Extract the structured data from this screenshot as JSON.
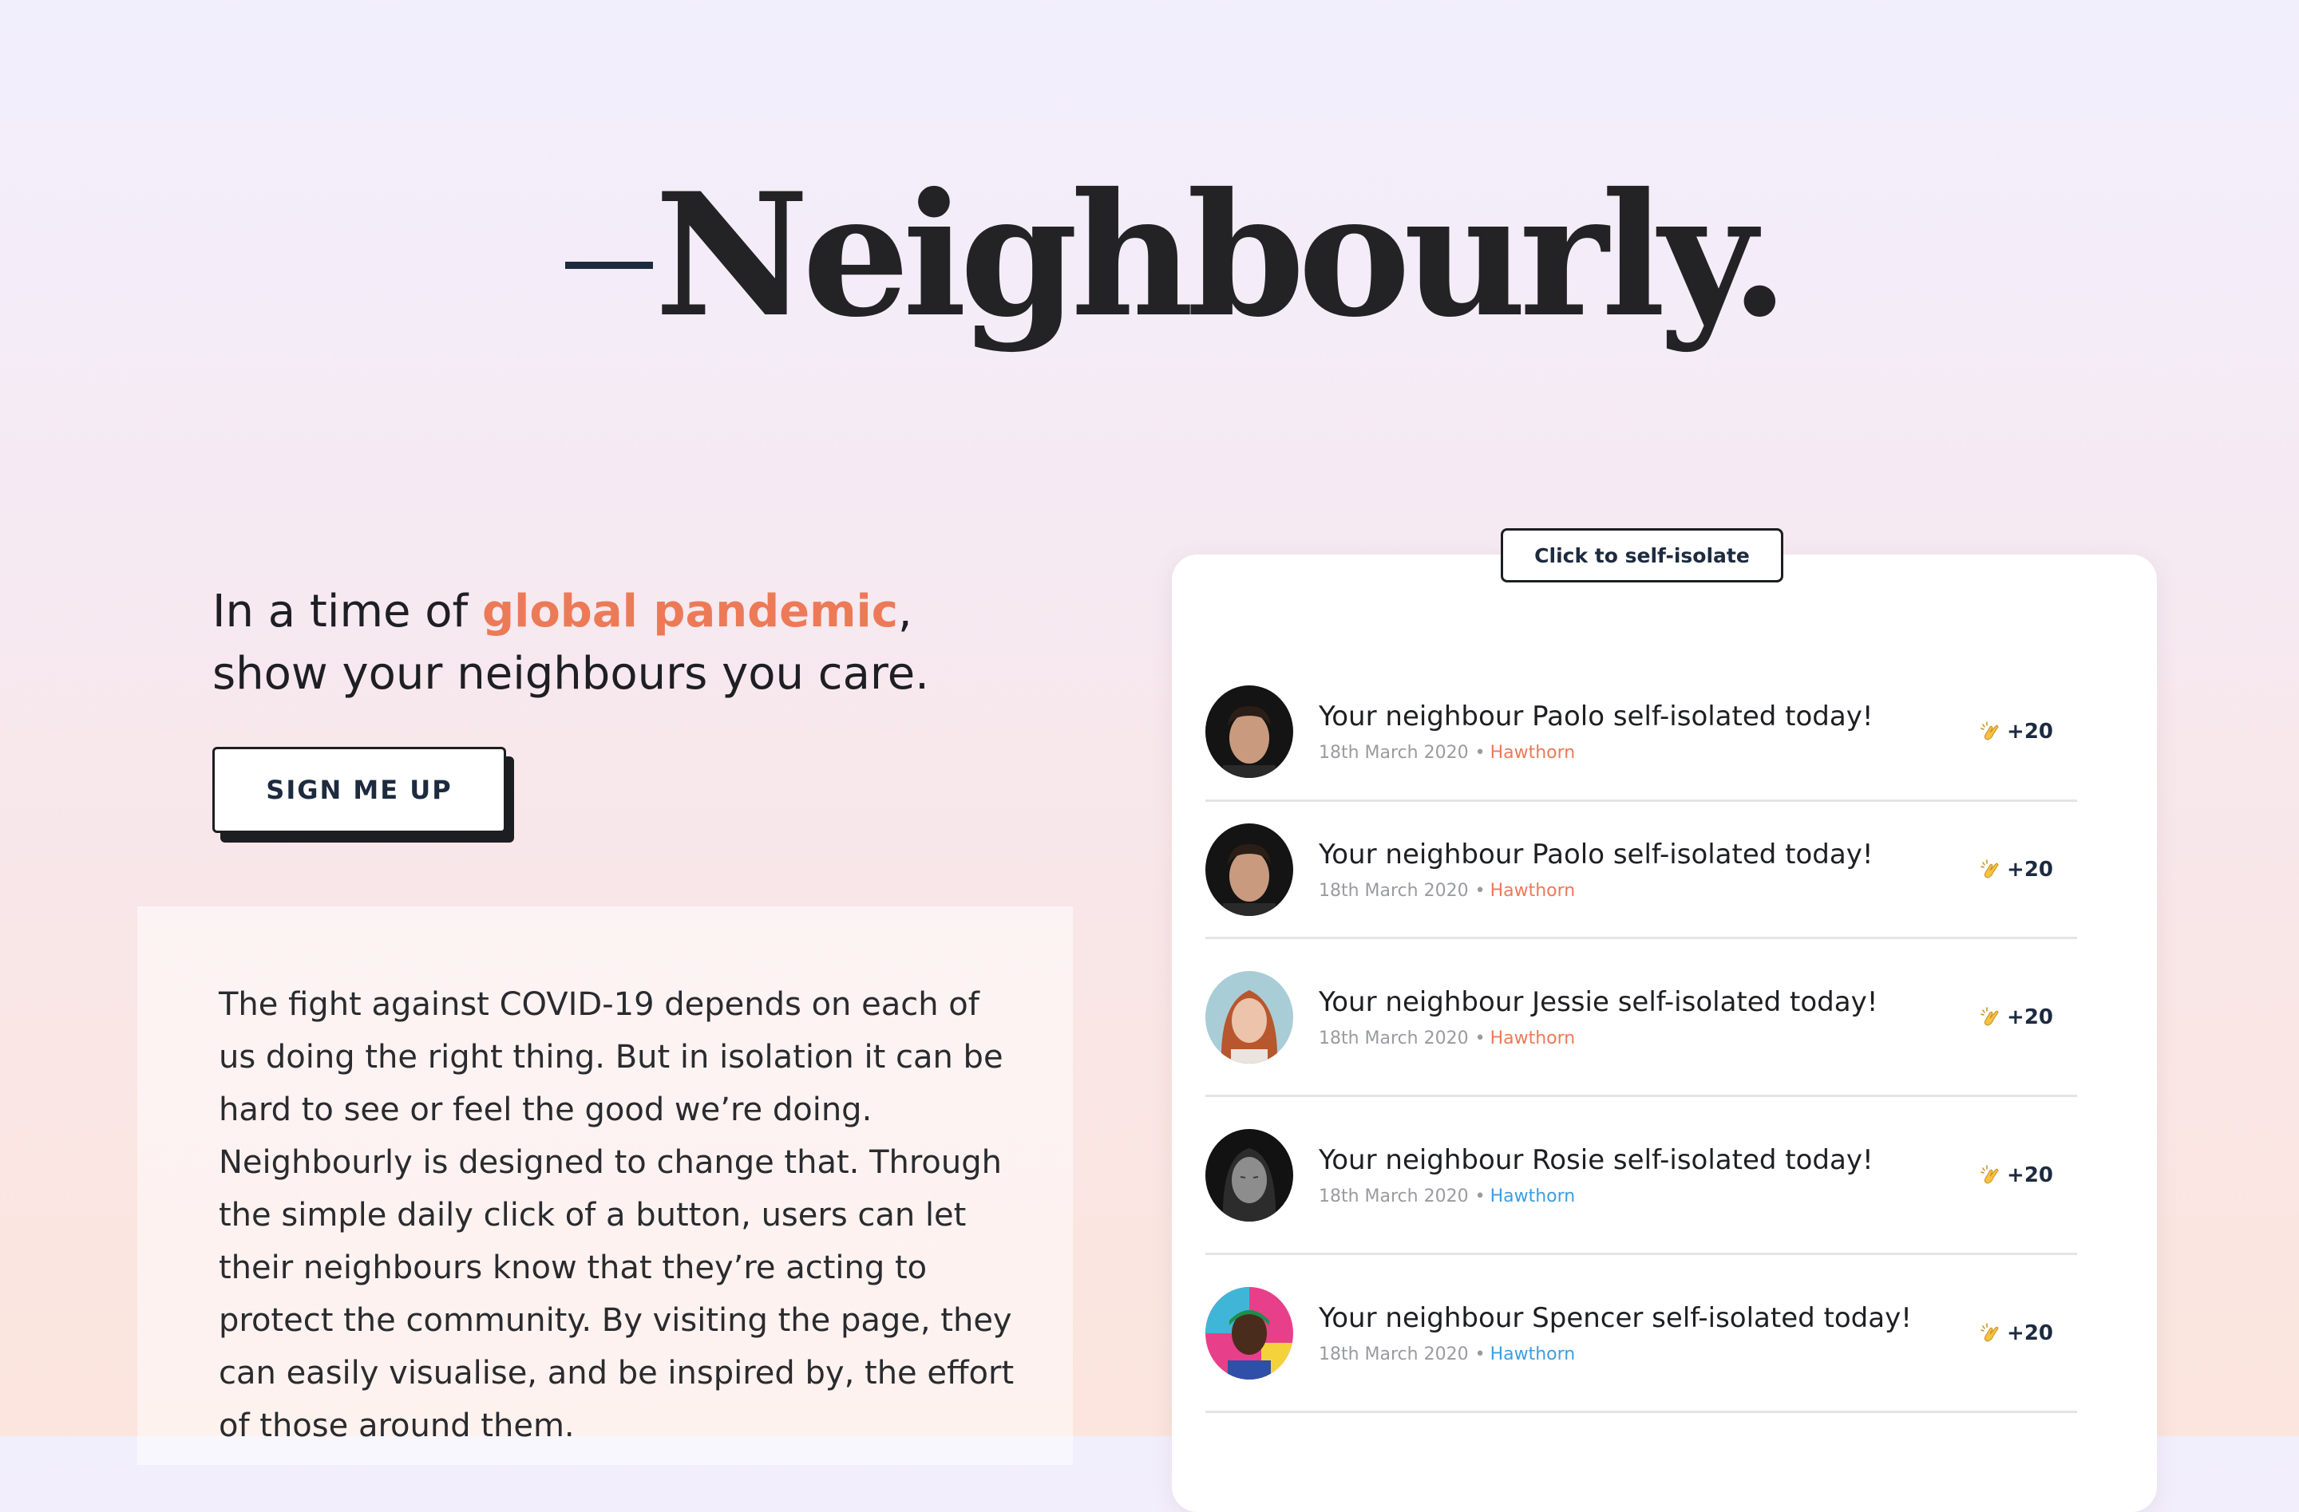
{
  "brand": {
    "logo_text": "Neighbourly."
  },
  "hero": {
    "headline_before": "In a time of ",
    "headline_accent": "global pandemic",
    "headline_after": ", show your neighbours you care.",
    "signup_label": "SIGN ME UP"
  },
  "about": {
    "text": "The fight against COVID-19 depends on each of us doing the right thing. But in isolation it can be hard to see or feel the good we’re doing. Neighbourly is designed to change that. Through the simple daily click of a button, users can let their neighbours know that they’re acting to protect the community. By visiting the page, they can easily visualise, and be inspired by, the effort of those around them."
  },
  "feed": {
    "self_isolate_label": "Click to self-isolate",
    "separator": "•",
    "items": [
      {
        "title": "Your neighbour Paolo self-isolated today!",
        "date": "18th March 2020",
        "place": "Hawthorn",
        "place_color": "orange",
        "clap_count": "+20",
        "avatar": "man-dark-hair-avatar"
      },
      {
        "title": "Your neighbour Paolo self-isolated today!",
        "date": "18th March 2020",
        "place": "Hawthorn",
        "place_color": "orange",
        "clap_count": "+20",
        "avatar": "man-dark-hair-avatar"
      },
      {
        "title": "Your neighbour Jessie self-isolated today!",
        "date": "18th March 2020",
        "place": "Hawthorn",
        "place_color": "orange",
        "clap_count": "+20",
        "avatar": "woman-red-hair-avatar"
      },
      {
        "title": "Your neighbour Rosie self-isolated today!",
        "date": "18th March 2020",
        "place": "Hawthorn",
        "place_color": "blue",
        "clap_count": "+20",
        "avatar": "woman-monochrome-avatar"
      },
      {
        "title": "Your neighbour Spencer self-isolated today!",
        "date": "18th March 2020",
        "place": "Hawthorn",
        "place_color": "blue",
        "clap_count": "+20",
        "avatar": "man-colorful-avatar"
      }
    ]
  },
  "colors": {
    "accent_orange": "#ec7a57",
    "link_blue": "#3d9ee0",
    "ink": "#1d2b3f"
  },
  "icons": {
    "clap": "clapping-hands-icon"
  }
}
